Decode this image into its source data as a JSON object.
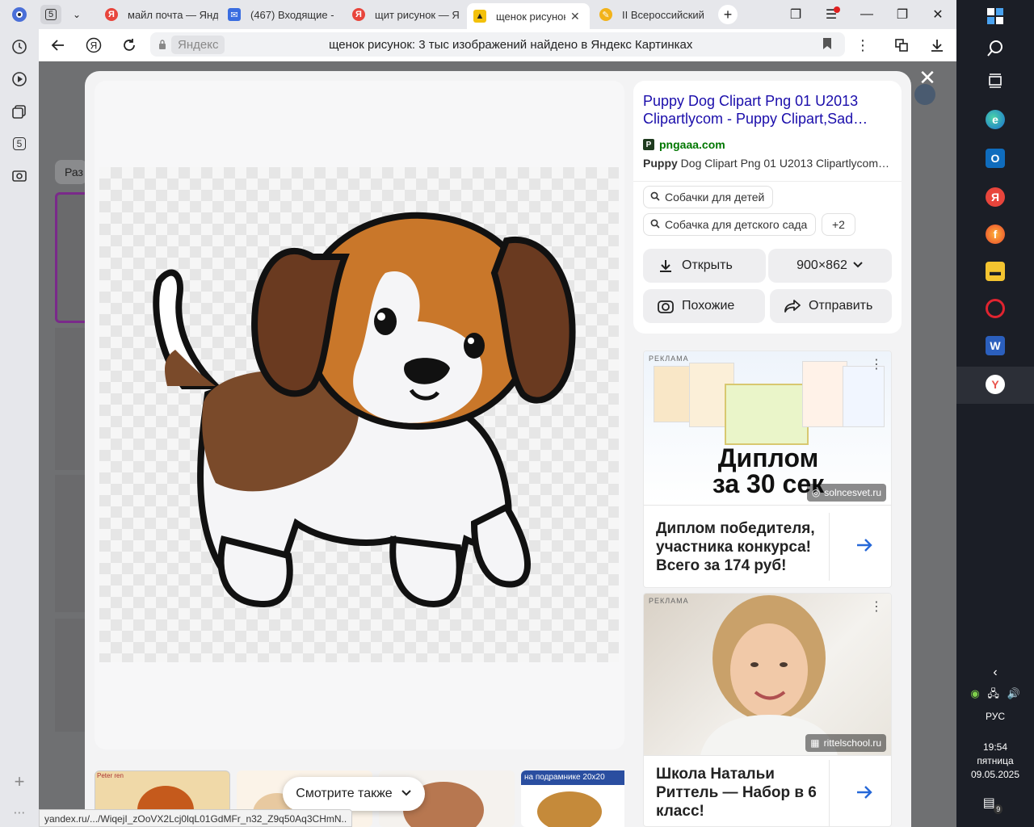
{
  "browser": {
    "workspace_count": "5",
    "tabs": [
      {
        "title": "майл почта — Янд"
      },
      {
        "title": "(467) Входящие -"
      },
      {
        "title": "щит рисунок — Я"
      },
      {
        "title": "щенок рисунок"
      },
      {
        "title": "II Всероссийский"
      }
    ],
    "address": {
      "host": "Яндекс",
      "title": "щенок рисунок: 3 тыс изображений найдено в Яндекс Картинках"
    },
    "sidebar_badge": "5",
    "status_url": "yandex.ru/.../WiqejI_zOoVX2Lcj0lqL01GdMFr_n32_Z9q50Aq3CHmN.."
  },
  "page": {
    "filter_stub": "Раз"
  },
  "viewer": {
    "title": "Puppy Dog Clipart Png 01 U2013 Clipartlycom - Puppy Clipart,Sad…",
    "domain": "pngaaa.com",
    "desc_bold": "Puppy",
    "desc_rest": " Dog Clipart Png 01 U2013 Clipartlycom…",
    "chips": [
      {
        "label": "Собачки для детей"
      },
      {
        "label": "Собачка для детского сада"
      },
      {
        "label": "+2"
      }
    ],
    "open_label": "Открыть",
    "size_label": "900×862",
    "similar_label": "Похожие",
    "share_label": "Отправить",
    "see_also_label": "Смотрите также",
    "thumb_captions": [
      "Peter ren",
      "на подрамнике 20x20"
    ]
  },
  "ads": [
    {
      "label": "РЕКЛАМА",
      "banner_line1": "Диплом",
      "banner_line2": "за 30 сек",
      "domain": "solncesvet.ru",
      "text": "Диплом победителя, участника конкурса! Всего за 174 руб!"
    },
    {
      "label": "РЕКЛАМА",
      "domain": "rittelschool.ru",
      "text": "Школа Натальи Риттель — Набор в 6 класс!"
    }
  ],
  "taskbar": {
    "language": "РУС",
    "time": "19:54",
    "weekday": "пятница",
    "date": "09.05.2025",
    "notifications": "9"
  }
}
